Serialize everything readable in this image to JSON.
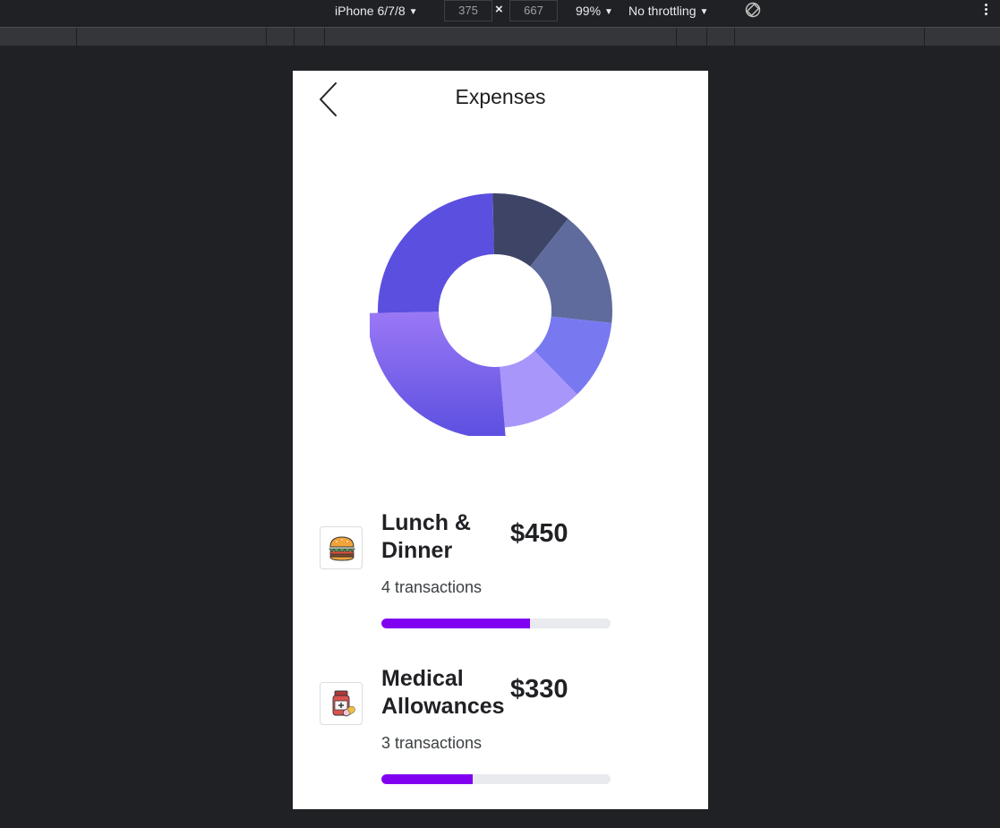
{
  "devtools": {
    "device": "iPhone 6/7/8",
    "width": "375",
    "height": "667",
    "times": "×",
    "zoom": "99%",
    "throttling": "No throttling"
  },
  "header": {
    "title": "Expenses"
  },
  "chart_data": {
    "type": "pie",
    "variant": "donut",
    "segments": [
      {
        "value": 11,
        "color": "#3d4466"
      },
      {
        "value": 16,
        "color": "#5f6b9c"
      },
      {
        "value": 11,
        "color": "#7879f1"
      },
      {
        "value": 11,
        "color": "#a996fb"
      },
      {
        "value": 26,
        "color": "#7154e6"
      },
      {
        "value": 25,
        "color": "#5b4fe0"
      }
    ]
  },
  "expenses": [
    {
      "name_line1": "Lunch &",
      "name_line2": "Dinner",
      "amount": "$450",
      "transactions": "4 transactions",
      "progress": 0.65,
      "icon": "burger-icon"
    },
    {
      "name_line1": "Medical",
      "name_line2": "Allowances",
      "amount": "$330",
      "transactions": "3 transactions",
      "progress": 0.4,
      "icon": "medicine-icon"
    }
  ],
  "colors": {
    "progress": "#8000f0",
    "track": "#e8eaed",
    "devtools_bg": "#202124"
  }
}
